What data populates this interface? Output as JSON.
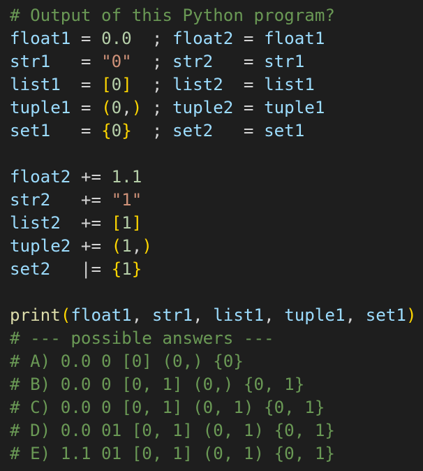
{
  "editor": {
    "lines": [
      [
        {
          "t": "comment",
          "v": "# Output of this Python program?"
        }
      ],
      [
        {
          "t": "var",
          "v": "float1"
        },
        {
          "t": "op",
          "v": " = "
        },
        {
          "t": "num",
          "v": "0.0"
        },
        {
          "t": "op",
          "v": "  ; "
        },
        {
          "t": "var",
          "v": "float2"
        },
        {
          "t": "op",
          "v": " = "
        },
        {
          "t": "var",
          "v": "float1"
        }
      ],
      [
        {
          "t": "var",
          "v": "str1"
        },
        {
          "t": "op",
          "v": "   = "
        },
        {
          "t": "str",
          "v": "\"0\""
        },
        {
          "t": "op",
          "v": "  ; "
        },
        {
          "t": "var",
          "v": "str2"
        },
        {
          "t": "op",
          "v": "   = "
        },
        {
          "t": "var",
          "v": "str1"
        }
      ],
      [
        {
          "t": "var",
          "v": "list1"
        },
        {
          "t": "op",
          "v": "  = "
        },
        {
          "t": "br",
          "v": "["
        },
        {
          "t": "num",
          "v": "0"
        },
        {
          "t": "br",
          "v": "]"
        },
        {
          "t": "op",
          "v": "  ; "
        },
        {
          "t": "var",
          "v": "list2"
        },
        {
          "t": "op",
          "v": "  = "
        },
        {
          "t": "var",
          "v": "list1"
        }
      ],
      [
        {
          "t": "var",
          "v": "tuple1"
        },
        {
          "t": "op",
          "v": " = "
        },
        {
          "t": "br",
          "v": "("
        },
        {
          "t": "num",
          "v": "0"
        },
        {
          "t": "op",
          "v": ","
        },
        {
          "t": "br",
          "v": ")"
        },
        {
          "t": "op",
          "v": " ; "
        },
        {
          "t": "var",
          "v": "tuple2"
        },
        {
          "t": "op",
          "v": " = "
        },
        {
          "t": "var",
          "v": "tuple1"
        }
      ],
      [
        {
          "t": "var",
          "v": "set1"
        },
        {
          "t": "op",
          "v": "   = "
        },
        {
          "t": "br",
          "v": "{"
        },
        {
          "t": "num",
          "v": "0"
        },
        {
          "t": "br",
          "v": "}"
        },
        {
          "t": "op",
          "v": "  ; "
        },
        {
          "t": "var",
          "v": "set2"
        },
        {
          "t": "op",
          "v": "   = "
        },
        {
          "t": "var",
          "v": "set1"
        }
      ],
      [],
      [
        {
          "t": "var",
          "v": "float2"
        },
        {
          "t": "op",
          "v": " += "
        },
        {
          "t": "num",
          "v": "1.1"
        }
      ],
      [
        {
          "t": "var",
          "v": "str2"
        },
        {
          "t": "op",
          "v": "   += "
        },
        {
          "t": "str",
          "v": "\"1\""
        }
      ],
      [
        {
          "t": "var",
          "v": "list2"
        },
        {
          "t": "op",
          "v": "  += "
        },
        {
          "t": "br",
          "v": "["
        },
        {
          "t": "num",
          "v": "1"
        },
        {
          "t": "br",
          "v": "]"
        }
      ],
      [
        {
          "t": "var",
          "v": "tuple2"
        },
        {
          "t": "op",
          "v": " += "
        },
        {
          "t": "br",
          "v": "("
        },
        {
          "t": "num",
          "v": "1"
        },
        {
          "t": "op",
          "v": ","
        },
        {
          "t": "br",
          "v": ")"
        }
      ],
      [
        {
          "t": "var",
          "v": "set2"
        },
        {
          "t": "op",
          "v": "   |= "
        },
        {
          "t": "br",
          "v": "{"
        },
        {
          "t": "num",
          "v": "1"
        },
        {
          "t": "br",
          "v": "}"
        }
      ],
      [],
      [
        {
          "t": "fn",
          "v": "print"
        },
        {
          "t": "br",
          "v": "("
        },
        {
          "t": "var",
          "v": "float1"
        },
        {
          "t": "op",
          "v": ", "
        },
        {
          "t": "var",
          "v": "str1"
        },
        {
          "t": "op",
          "v": ", "
        },
        {
          "t": "var",
          "v": "list1"
        },
        {
          "t": "op",
          "v": ", "
        },
        {
          "t": "var",
          "v": "tuple1"
        },
        {
          "t": "op",
          "v": ", "
        },
        {
          "t": "var",
          "v": "set1"
        },
        {
          "t": "br",
          "v": ")"
        }
      ],
      [
        {
          "t": "comment",
          "v": "# --- possible answers ---"
        }
      ],
      [
        {
          "t": "comment",
          "v": "# A) 0.0 0 [0] (0,) {0}"
        }
      ],
      [
        {
          "t": "comment",
          "v": "# B) 0.0 0 [0, 1] (0,) {0, 1}"
        }
      ],
      [
        {
          "t": "comment",
          "v": "# C) 0.0 0 [0, 1] (0, 1) {0, 1}"
        }
      ],
      [
        {
          "t": "comment",
          "v": "# D) 0.0 01 [0, 1] (0, 1) {0, 1}"
        }
      ],
      [
        {
          "t": "comment",
          "v": "# E) 1.1 01 [0, 1] (0, 1) {0, 1}"
        }
      ]
    ]
  },
  "colors": {
    "background": "#1e1e1e",
    "comment": "#6a9955",
    "variable": "#9cdcfe",
    "number": "#b5cea8",
    "string": "#ce9178",
    "operator": "#d4d4d4",
    "bracket": "#ffd700",
    "function": "#dcdcaa"
  }
}
